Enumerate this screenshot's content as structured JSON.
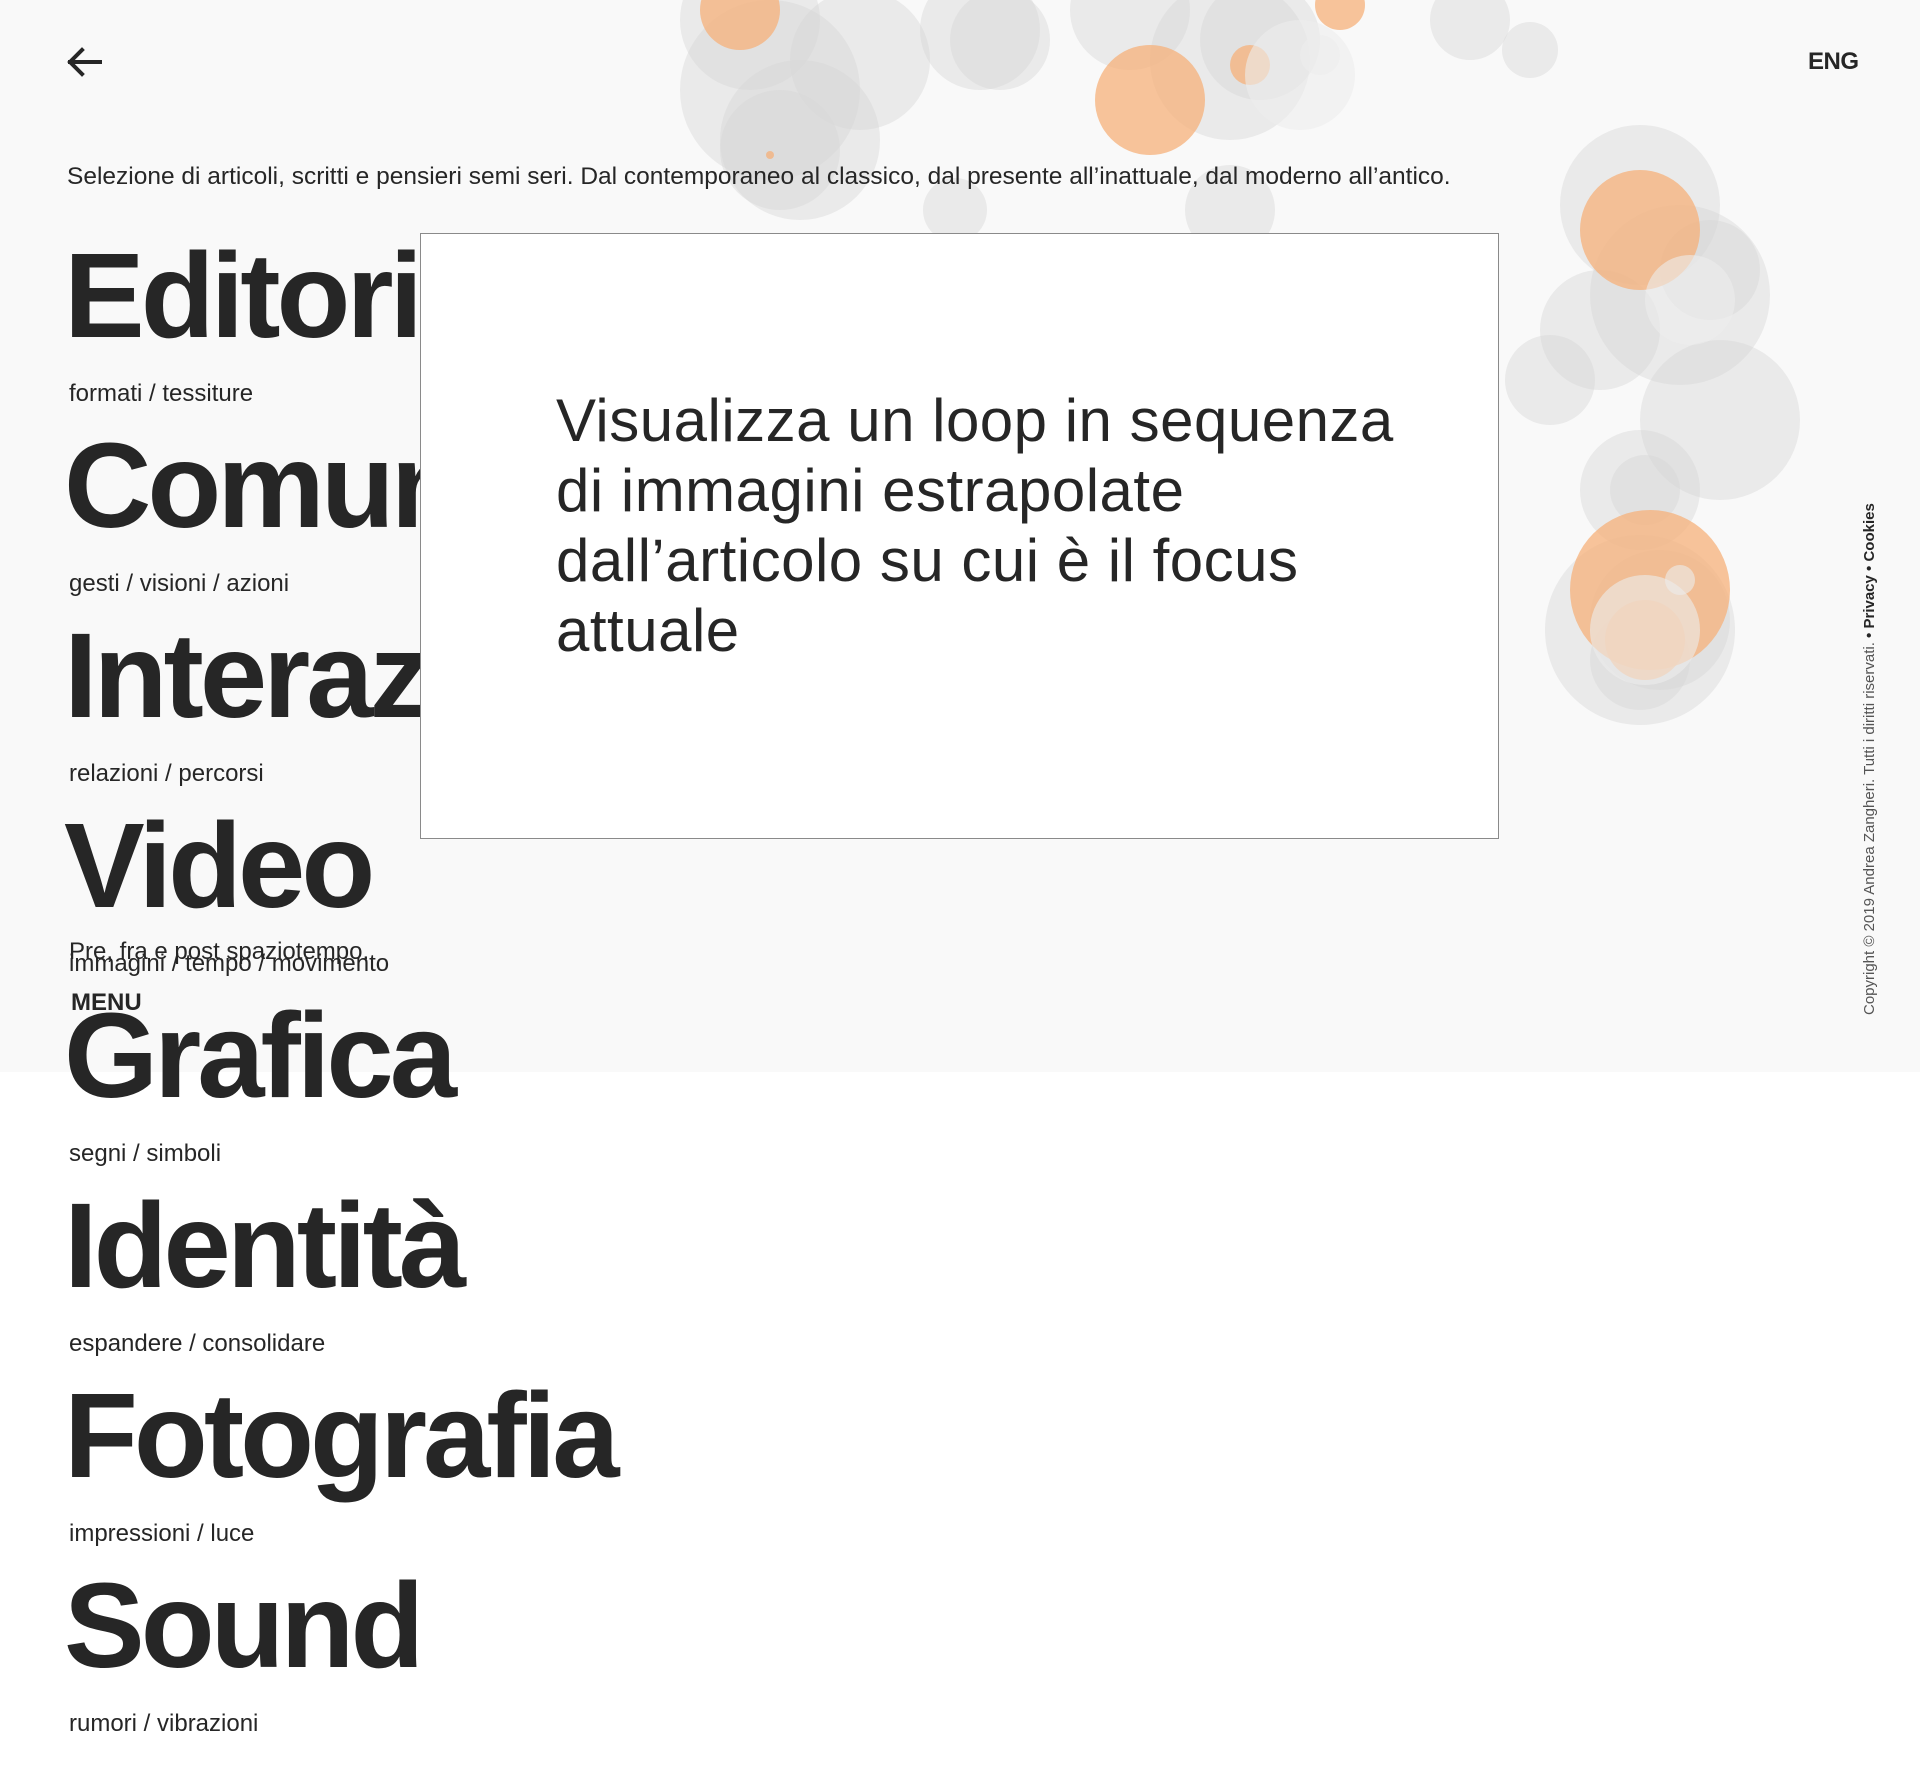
{
  "header": {
    "back_icon": "arrow-left-icon",
    "lang_label": "ENG"
  },
  "intro_text": "Selezione di articoli, scritti e pensieri semi seri. Dal contemporaneo al classico, dal presente all’inattuale, dal moderno all’antico.",
  "categories": [
    {
      "title": "Editoria",
      "subtitle": "formati / tessiture"
    },
    {
      "title": "Comunicazione",
      "subtitle": "gesti / visioni / azioni"
    },
    {
      "title": "Interazione",
      "subtitle": "relazioni / percorsi"
    },
    {
      "title": "Video",
      "subtitle": "immagini / tempo / movimento"
    },
    {
      "title": "Grafica",
      "subtitle": "segni / simboli"
    },
    {
      "title": "Identità",
      "subtitle": "espandere / consolidare"
    },
    {
      "title": "Fotografia",
      "subtitle": "impressioni / luce"
    },
    {
      "title": "Sound",
      "subtitle": "rumori / vibrazioni"
    }
  ],
  "tagline": "Pre, fra e post spaziotempo.",
  "menu_label": "MENU",
  "popup": {
    "text": "Visualizza un loop in sequenza di immagini estrapolate dall’articolo su cui è il focus attuale"
  },
  "footer": {
    "copyright": "Copyright © 2019 Andrea Zangheri. Tutti i diritti riservati.",
    "privacy": "• Privacy",
    "cookies": "• Cookies"
  },
  "colors": {
    "background_top": "#f9f9f9",
    "text": "#262626",
    "bubble_gray": "#d9d9d9",
    "bubble_orange": "#f5b07a"
  }
}
